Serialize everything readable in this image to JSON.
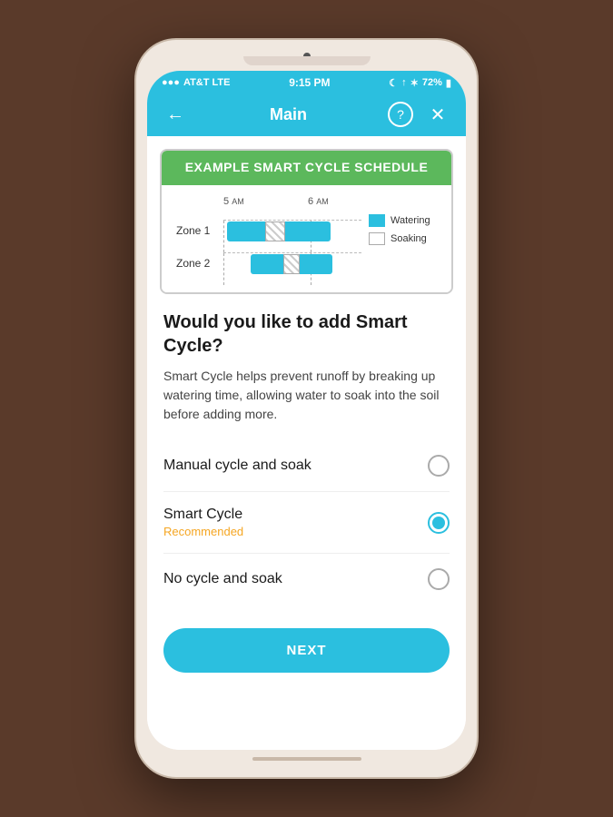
{
  "status_bar": {
    "carrier": "AT&T LTE",
    "time": "9:15 PM",
    "battery": "72%"
  },
  "nav": {
    "title": "Main",
    "back_label": "←",
    "help_label": "?",
    "close_label": "✕"
  },
  "chart": {
    "header": "EXAMPLE SMART CYCLE SCHEDULE",
    "time_labels": [
      "5 AM",
      "6 AM"
    ],
    "zones": [
      "Zone 1",
      "Zone 2"
    ],
    "legend": [
      {
        "label": "Watering",
        "type": "blue"
      },
      {
        "label": "Soaking",
        "type": "white"
      }
    ]
  },
  "question": {
    "heading": "Would you like to add Smart Cycle?",
    "description": "Smart Cycle helps prevent runoff by breaking up watering time, allowing water to soak into the soil before adding more."
  },
  "options": [
    {
      "id": "manual",
      "label": "Manual cycle and soak",
      "sublabel": "",
      "selected": false
    },
    {
      "id": "smart",
      "label": "Smart Cycle",
      "sublabel": "Recommended",
      "selected": true
    },
    {
      "id": "none",
      "label": "No cycle and soak",
      "sublabel": "",
      "selected": false
    }
  ],
  "button": {
    "next_label": "NEXT"
  }
}
